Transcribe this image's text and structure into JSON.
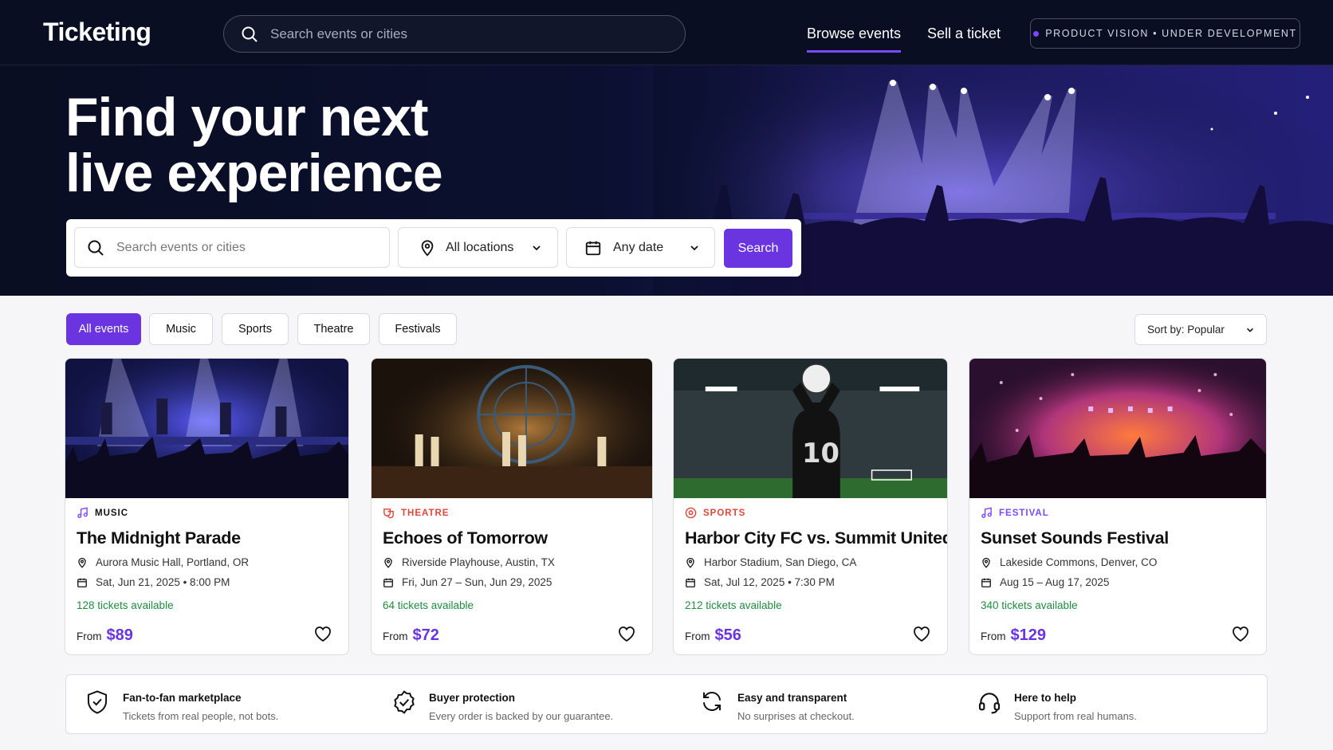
{
  "nav": {
    "brand": "Ticketing",
    "search_placeholder": "Search events or cities",
    "links": [
      "Browse events",
      "Sell a ticket"
    ],
    "badge": "PRODUCT VISION • UNDER DEVELOPMENT"
  },
  "hero": {
    "title_line1": "Find your next",
    "title_line2": "live experience",
    "search_placeholder": "Search events or cities",
    "location": "All locations",
    "date": "Any date",
    "search_button": "Search"
  },
  "filters": {
    "chips": [
      "All events",
      "Music",
      "Sports",
      "Theatre",
      "Festivals"
    ],
    "active": "All events",
    "sort_label": "Sort by:",
    "sort_value": "Popular"
  },
  "events": [
    {
      "category": "MUSIC",
      "title": "The Midnight Parade",
      "venue": "Aurora Music Hall, Portland, OR",
      "date": "Sat, Jun 21, 2025 • 8:00 PM",
      "availability": "128 tickets available",
      "from_label": "From",
      "price": "$89"
    },
    {
      "category": "THEATRE",
      "title": "Echoes of Tomorrow",
      "venue": "Riverside Playhouse, Austin, TX",
      "date": "Fri, Jun 27 – Sun, Jun 29, 2025",
      "availability": "64 tickets available",
      "from_label": "From",
      "price": "$72"
    },
    {
      "category": "SPORTS",
      "title": "Harbor City FC vs. Summit United",
      "venue": "Harbor Stadium, San Diego, CA",
      "date": "Sat, Jul 12, 2025 • 7:30 PM",
      "availability": "212 tickets available",
      "from_label": "From",
      "price": "$56"
    },
    {
      "category": "FESTIVAL",
      "title": "Sunset Sounds Festival",
      "venue": "Lakeside Commons, Denver, CO",
      "date": "Aug 15 – Aug 17, 2025",
      "availability": "340 tickets available",
      "from_label": "From",
      "price": "$129"
    }
  ],
  "features": [
    {
      "title": "Fan-to-fan marketplace",
      "subtitle": "Tickets from real people, not bots."
    },
    {
      "title": "Buyer protection",
      "subtitle": "Every order is backed by our guarantee."
    },
    {
      "title": "Easy and transparent",
      "subtitle": "No surprises at checkout."
    },
    {
      "title": "Here to help",
      "subtitle": "Support from real humans."
    }
  ],
  "colors": {
    "accent": "#6a35e0",
    "nav_bg": "#0a0e22",
    "available_green": "#1e8e3e",
    "music": "#7b49ff",
    "theatre": "#e0453a",
    "sports": "#e0453a",
    "festival": "#7b49ff"
  }
}
